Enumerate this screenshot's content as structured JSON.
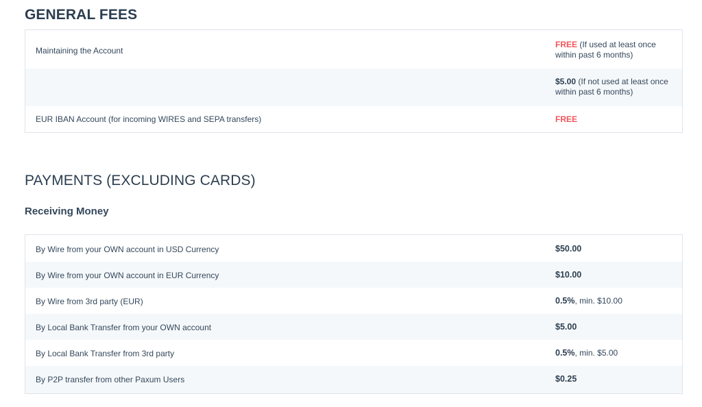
{
  "general_fees": {
    "heading": "GENERAL FEES",
    "rows": [
      {
        "label": "Maintaining the Account",
        "value_strong": "FREE",
        "value_note": " (If used at least once within past 6 months)"
      },
      {
        "label": "",
        "value_strong": "$5.00",
        "value_note": " (If not used at least once within past 6 months)"
      },
      {
        "label": "EUR IBAN Account (for incoming WIRES and SEPA transfers)",
        "value_strong": "FREE",
        "value_note": ""
      }
    ]
  },
  "payments": {
    "heading": "PAYMENTS (EXCLUDING CARDS)",
    "subheading": "Receiving Money",
    "rows": [
      {
        "label": "By Wire from your OWN account in USD Currency",
        "value_strong": "$50.00",
        "value_note": ""
      },
      {
        "label": "By Wire from your OWN account in EUR Currency",
        "value_strong": "$10.00",
        "value_note": ""
      },
      {
        "label": "By Wire from 3rd party (EUR)",
        "value_strong": "0.5%",
        "value_note": ", min. $10.00"
      },
      {
        "label": "By Local Bank Transfer from your OWN account",
        "value_strong": "$5.00",
        "value_note": ""
      },
      {
        "label": "By Local Bank Transfer from 3rd party",
        "value_strong": "0.5%",
        "value_note": ", min. $5.00"
      },
      {
        "label": "By P2P transfer from other Paxum Users",
        "value_strong": "$0.25",
        "value_note": ""
      }
    ]
  },
  "colors": {
    "free_red": "#f2545b",
    "heading": "#2c3e50",
    "row_alt": "#f5f8fa",
    "border": "#dfe3eb"
  }
}
